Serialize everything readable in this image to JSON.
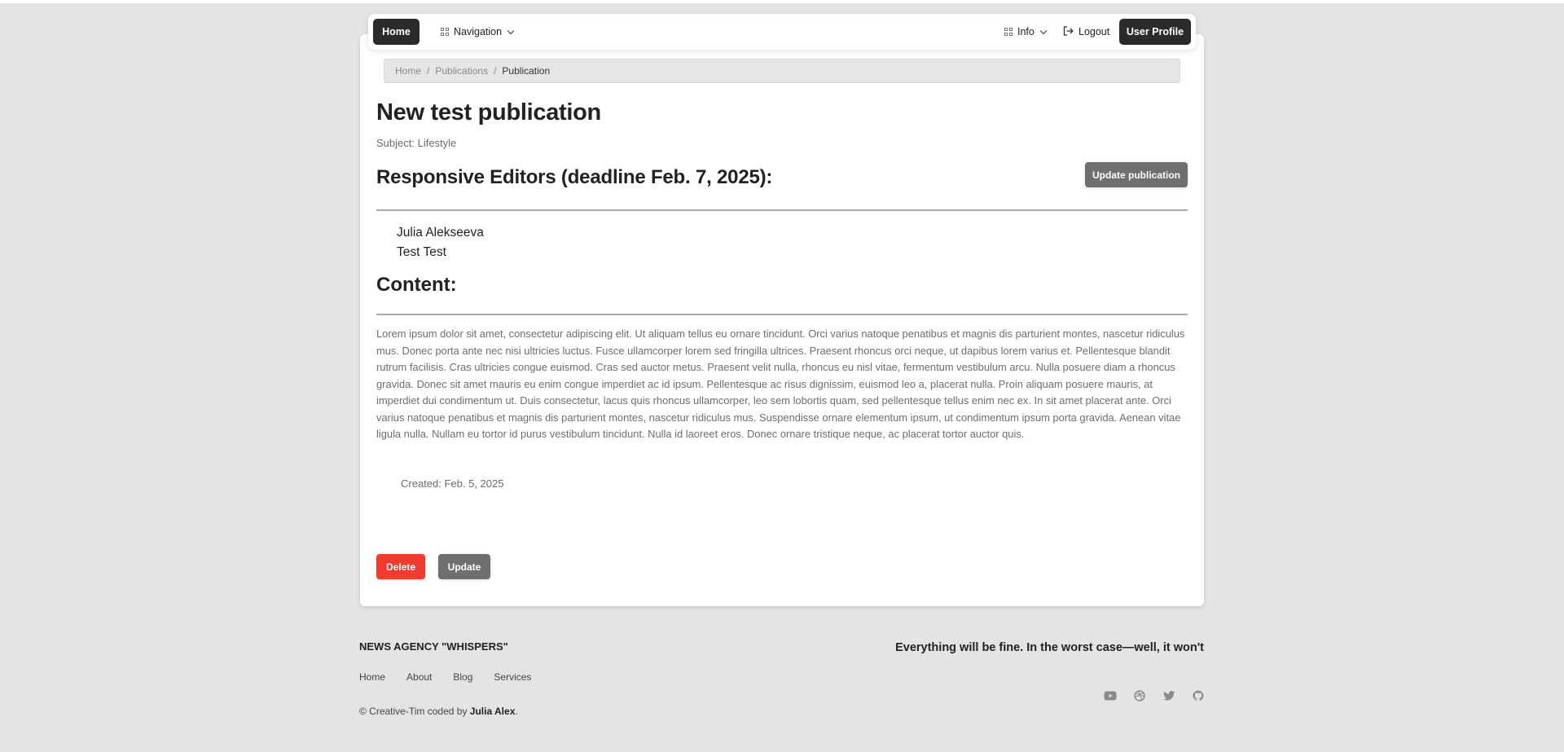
{
  "navbar": {
    "home_label": "Home",
    "navigation_label": "Navigation",
    "info_label": "Info",
    "logout_label": "Logout",
    "profile_label": "User Profile"
  },
  "breadcrumb": {
    "items": [
      "Home",
      "Publications",
      "Publication"
    ]
  },
  "publication": {
    "title": "New test publication",
    "subject": "Subject: Lifestyle",
    "editors_heading": "Responsive Editors (deadline Feb. 7, 2025):",
    "update_publication_label": "Update publication",
    "editors": [
      "Julia Alekseeva",
      "Test Test"
    ],
    "content_heading": "Content:",
    "content": "Lorem ipsum dolor sit amet, consectetur adipiscing elit. Ut aliquam tellus eu ornare tincidunt. Orci varius natoque penatibus et magnis dis parturient montes, nascetur ridiculus mus. Donec porta ante nec nisi ultricies luctus. Fusce ullamcorper lorem sed fringilla ultrices. Praesent rhoncus orci neque, ut dapibus lorem varius et. Pellentesque blandit rutrum facilisis. Cras ultricies congue euismod. Cras sed auctor metus. Praesent velit nulla, rhoncus eu nisl vitae, fermentum vestibulum arcu. Nulla posuere diam a rhoncus gravida. Donec sit amet mauris eu enim congue imperdiet ac id ipsum. Pellentesque ac risus dignissim, euismod leo a, placerat nulla. Proin aliquam posuere mauris, at imperdiet dui condimentum ut. Duis consectetur, lacus quis rhoncus ullamcorper, leo sem lobortis quam, sed pellentesque tellus enim nec ex. In sit amet placerat ante. Orci varius natoque penatibus et magnis dis parturient montes, nascetur ridiculus mus. Suspendisse ornare elementum ipsum, ut condimentum ipsum porta gravida. Aenean vitae ligula nulla. Nullam eu tortor id purus vestibulum tincidunt. Nulla id laoreet eros. Donec ornare tristique neque, ac placerat tortor auctor quis.",
    "created": "Created: Feb. 5, 2025",
    "delete_label": "Delete",
    "update_label": "Update"
  },
  "footer": {
    "brand": "NEWS AGENCY \"WHISPERS\"",
    "tagline": "Everything will be fine. In the worst case—well, it won't",
    "links": [
      "Home",
      "About",
      "Blog",
      "Services"
    ],
    "copyright_prefix": "© Creative-Tim coded by ",
    "copyright_author": "Julia Alex",
    "copyright_suffix": ".",
    "social_icons": [
      "youtube-icon",
      "dribbble-icon",
      "twitter-icon",
      "github-icon"
    ]
  },
  "colors": {
    "background": "#e4e4e4",
    "dark_button": "#2b2b2b",
    "grey_button": "#6f6f6f",
    "danger_button": "#f03b30"
  }
}
